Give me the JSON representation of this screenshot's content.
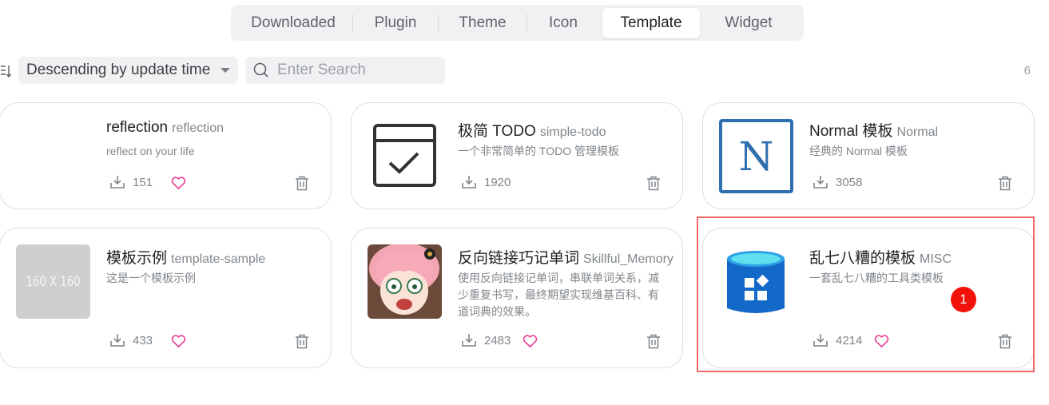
{
  "tabs": [
    {
      "label": "Downloaded",
      "active": false
    },
    {
      "label": "Plugin",
      "active": false
    },
    {
      "label": "Theme",
      "active": false
    },
    {
      "label": "Icon",
      "active": false
    },
    {
      "label": "Template",
      "active": true
    },
    {
      "label": "Widget",
      "active": false
    }
  ],
  "toolbar": {
    "sort_label": "Descending by update time",
    "search_placeholder": "Enter Search",
    "count": "6"
  },
  "cards": [
    {
      "title": "reflection",
      "subtitle": "reflection",
      "description": "reflect on your life",
      "downloads": "151",
      "thumb_icon": "blank-thumbnail"
    },
    {
      "title": "极简 TODO",
      "subtitle": "simple-todo",
      "description": "一个非常简单的 TODO 管理模板",
      "downloads": "1920",
      "thumb_icon": "checkbox-calendar-icon"
    },
    {
      "title": "Normal 模板",
      "subtitle": "Normal",
      "description": "经典的 Normal 模板",
      "downloads": "3058",
      "thumb_icon": "letter-n-icon",
      "thumb_letter": "N"
    },
    {
      "title": "模板示例",
      "subtitle": "template-sample",
      "description": "这是一个模板示例",
      "downloads": "433",
      "thumb_icon": "placeholder-image",
      "thumb_text": "160 X 160"
    },
    {
      "title": "反向链接巧记单词",
      "subtitle": "Skillful_Memory",
      "description": "使用反向链接记单词，串联单词关系，减少重复书写，最终期望实现维基百科、有道词典的效果。",
      "downloads": "2483",
      "thumb_icon": "anime-girl-avatar"
    },
    {
      "title": "乱七八糟的模板",
      "subtitle": "MISC",
      "description": "一套乱七八糟的工具类模板",
      "downloads": "4214",
      "thumb_icon": "azure-database-icon"
    }
  ],
  "annotation": {
    "badge": "1"
  },
  "colors": {
    "accent_heart": "#e8449a",
    "highlight_border": "#f06a63",
    "badge_bg": "#f3120a",
    "normal_blue": "#2f6fae"
  }
}
